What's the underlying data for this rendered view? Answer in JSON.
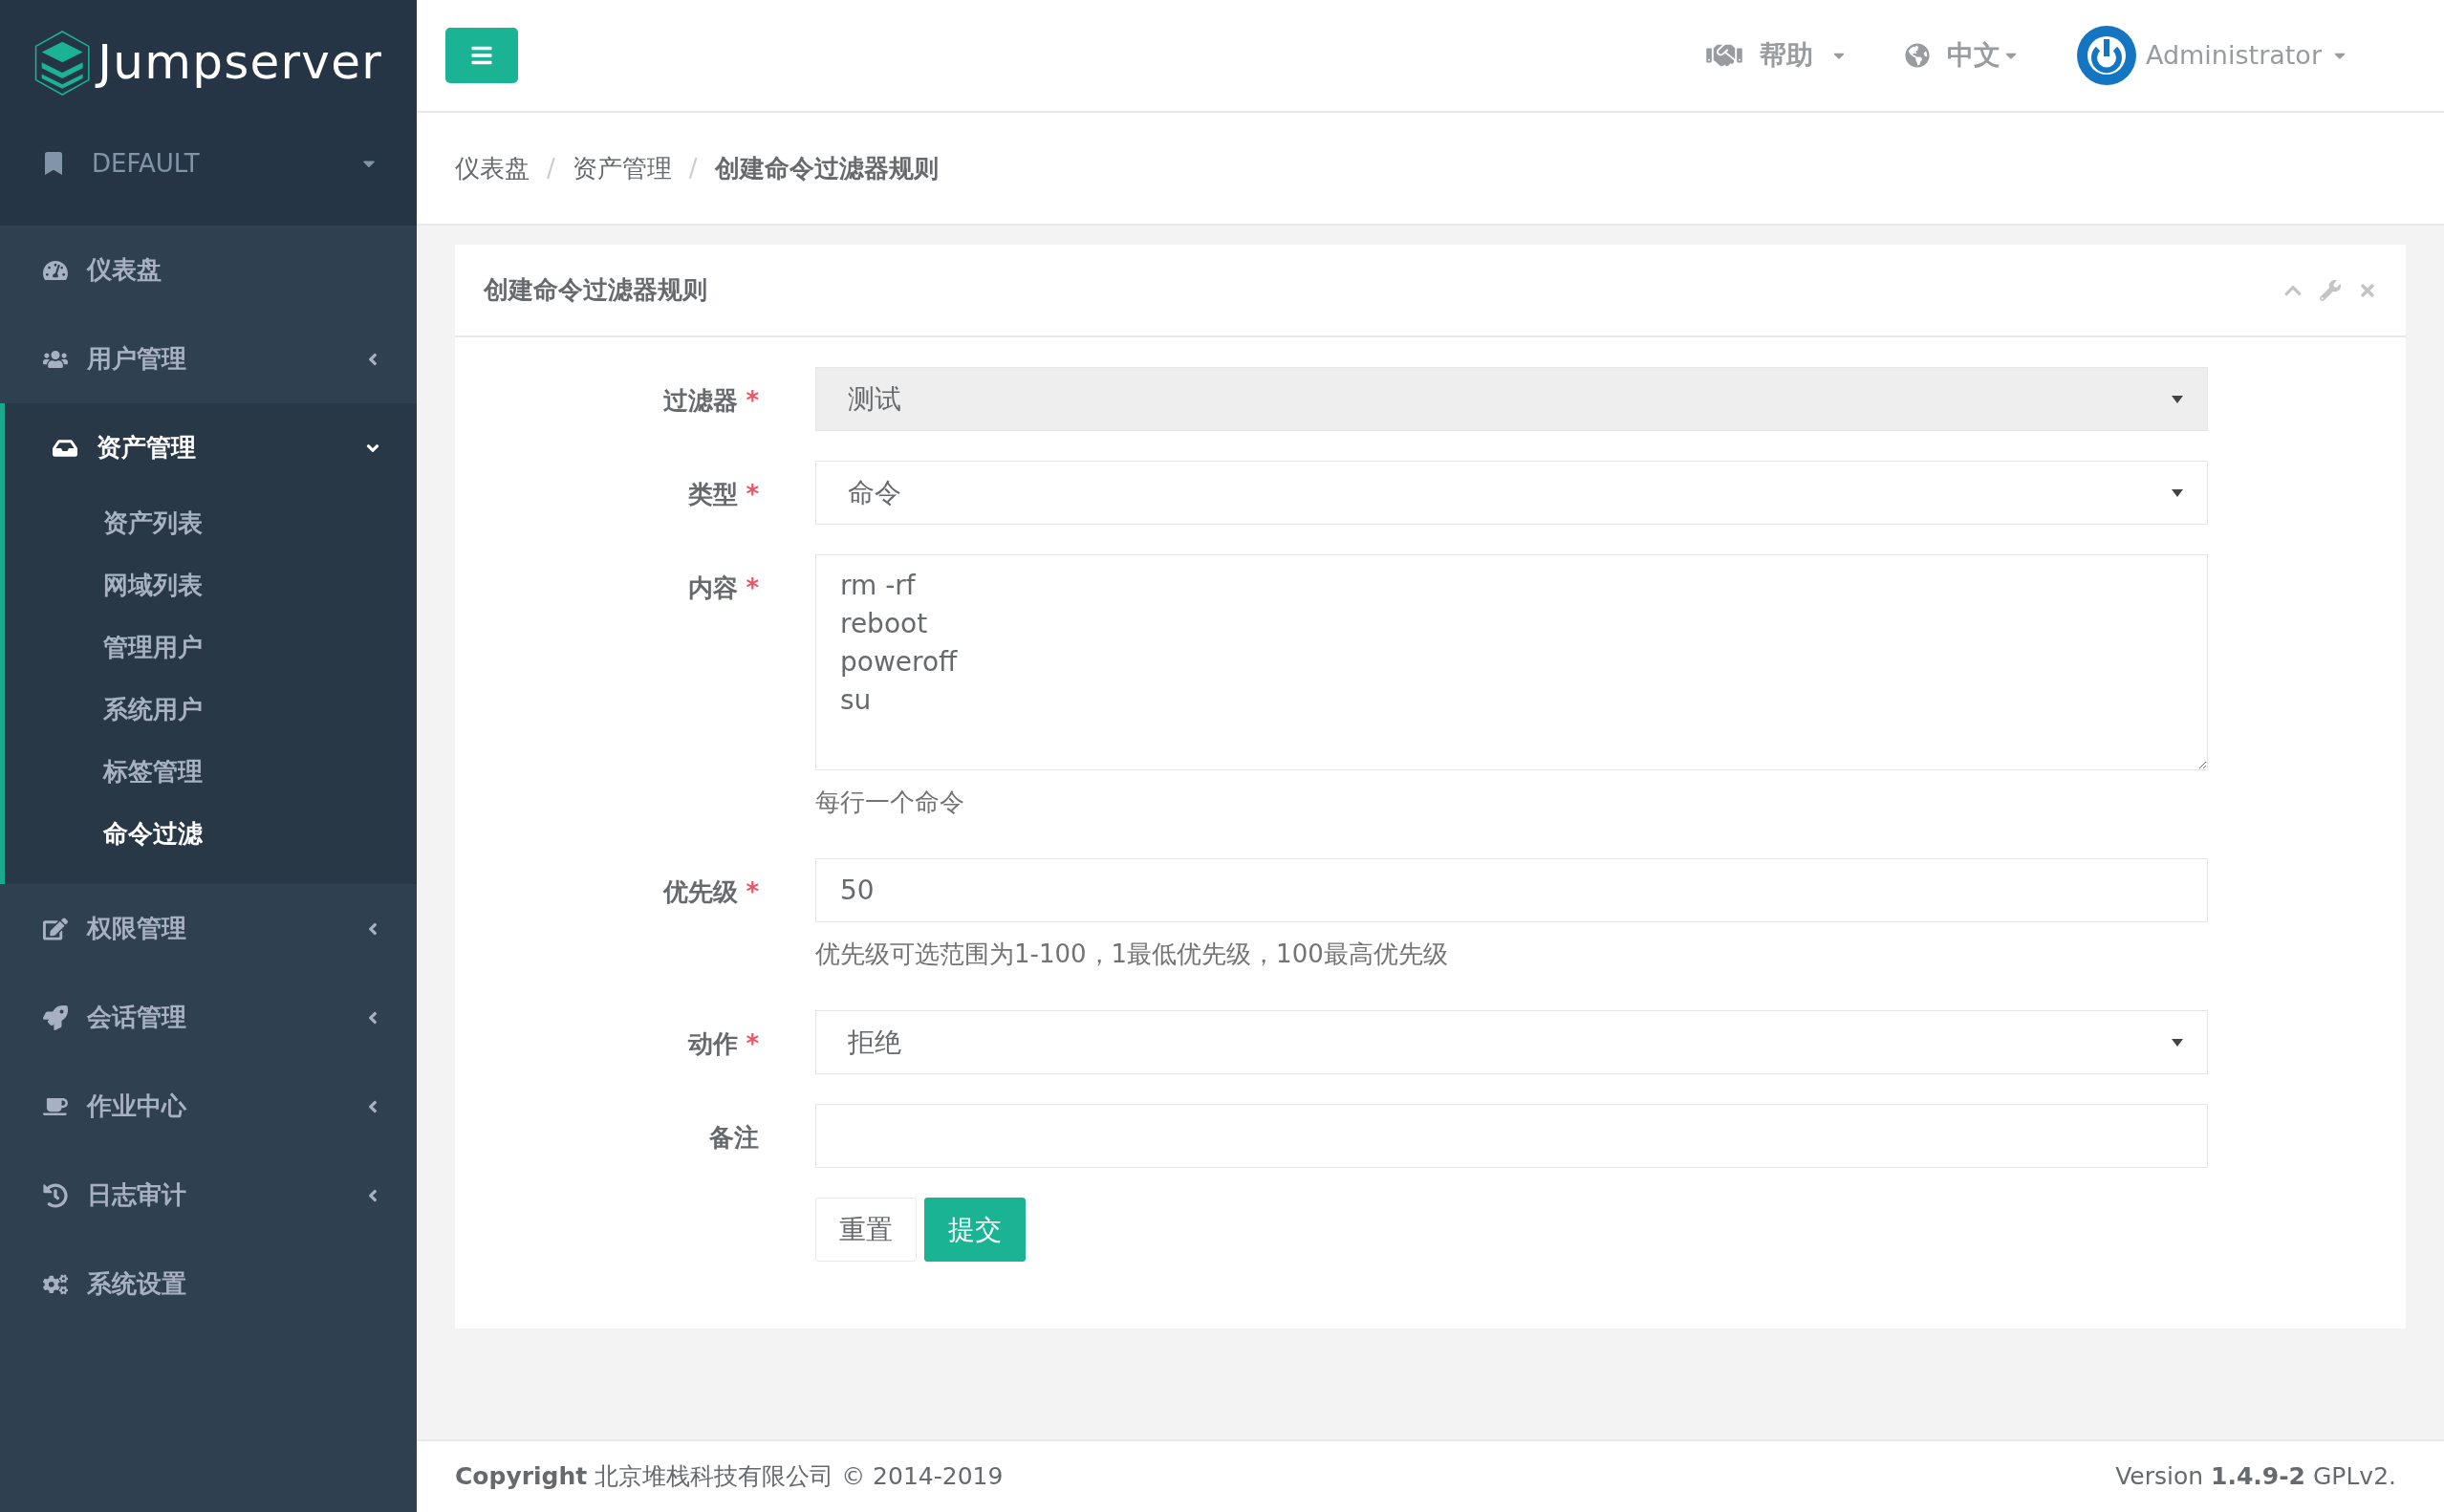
{
  "brand": {
    "name": "Jumpserver"
  },
  "org": {
    "label": "DEFAULT"
  },
  "nav": [
    {
      "label": "仪表盘",
      "kind": "link",
      "selected": false
    },
    {
      "label": "用户管理",
      "kind": "group",
      "expanded": false,
      "selected": false
    },
    {
      "label": "资产管理",
      "kind": "group",
      "expanded": true,
      "selected": true,
      "children": [
        {
          "label": "资产列表",
          "selected": false
        },
        {
          "label": "网域列表",
          "selected": false
        },
        {
          "label": "管理用户",
          "selected": false
        },
        {
          "label": "系统用户",
          "selected": false
        },
        {
          "label": "标签管理",
          "selected": false
        },
        {
          "label": "命令过滤",
          "selected": true
        }
      ]
    },
    {
      "label": "权限管理",
      "kind": "group",
      "expanded": false,
      "selected": false
    },
    {
      "label": "会话管理",
      "kind": "group",
      "expanded": false,
      "selected": false
    },
    {
      "label": "作业中心",
      "kind": "group",
      "expanded": false,
      "selected": false
    },
    {
      "label": "日志审计",
      "kind": "group",
      "expanded": false,
      "selected": false
    },
    {
      "label": "系统设置",
      "kind": "link",
      "selected": false
    }
  ],
  "topbar": {
    "help": "帮助",
    "language": "中文",
    "user": "Administrator"
  },
  "breadcrumb": {
    "separator": "/",
    "items": [
      "仪表盘",
      "资产管理",
      "创建命令过滤器规则"
    ]
  },
  "card": {
    "title": "创建命令过滤器规则",
    "required_mark": "*",
    "fields": [
      {
        "label": "过滤器",
        "kind": "select",
        "required": true,
        "disabled": true,
        "value": "测试"
      },
      {
        "label": "类型",
        "kind": "select",
        "required": true,
        "disabled": false,
        "value": "命令"
      },
      {
        "label": "内容",
        "kind": "textarea",
        "required": true,
        "disabled": false,
        "value": "rm -rf\nreboot\npoweroff\nsu",
        "help": "每行一个命令"
      },
      {
        "label": "优先级",
        "kind": "input",
        "required": true,
        "disabled": false,
        "value": "50",
        "help": "优先级可选范围为1-100，1最低优先级，100最高优先级"
      },
      {
        "label": "动作",
        "kind": "select",
        "required": true,
        "disabled": false,
        "value": "拒绝"
      },
      {
        "label": "备注",
        "kind": "input",
        "required": false,
        "disabled": false
      }
    ],
    "buttons": [
      {
        "label": "重置",
        "kind": "default"
      },
      {
        "label": "提交",
        "kind": "primary"
      }
    ]
  },
  "footer": {
    "copyright": "**Copyright** 北京堆栈科技有限公司 © 2014-2019",
    "version": "Version **1.4.9-2** GPLv2."
  }
}
